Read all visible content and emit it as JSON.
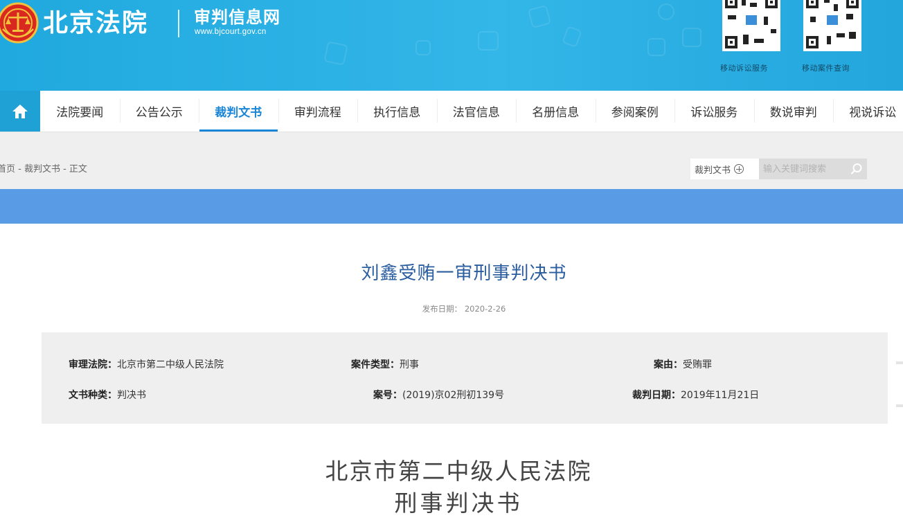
{
  "header": {
    "site_name": "北京法院",
    "subtitle": "审判信息网",
    "url": "www.bjcourt.gov.cn",
    "qr_codes": [
      {
        "caption": "移动诉讼服务"
      },
      {
        "caption": "移动案件查询"
      }
    ]
  },
  "nav": {
    "home_icon": "home-icon",
    "items": [
      {
        "label": "法院要闻"
      },
      {
        "label": "公告公示"
      },
      {
        "label": "裁判文书",
        "active": true
      },
      {
        "label": "审判流程"
      },
      {
        "label": "执行信息"
      },
      {
        "label": "法官信息"
      },
      {
        "label": "名册信息"
      },
      {
        "label": "参阅案例"
      },
      {
        "label": "诉讼服务"
      },
      {
        "label": "数说审判"
      },
      {
        "label": "视说诉讼"
      }
    ]
  },
  "breadcrumb": {
    "text": "首页 - 裁判文书 - 正文"
  },
  "search": {
    "category": "裁判文书",
    "placeholder": "输入关键词搜索"
  },
  "document": {
    "title": "刘鑫受贿一审刑事判决书",
    "publish_date_label": "发布日期：",
    "publish_date": "2020-2-26",
    "info": {
      "court_label": "审理法院：",
      "court": "北京市第二中级人民法院",
      "case_type_label": "案件类型：",
      "case_type": "刑事",
      "cause_label": "案由：",
      "cause": "受贿罪",
      "doc_kind_label": "文书种类：",
      "doc_kind": "判决书",
      "case_no_label": "案号：",
      "case_no": "(2019)京02刑初139号",
      "judgment_date_label": "裁判日期：",
      "judgment_date": "2019年11月21日"
    },
    "court_heading": "北京市第二中级人民法院",
    "doc_type_heading": "刑事判决书"
  },
  "colors": {
    "header_bg": "#2aaee2",
    "nav_home_bg": "#20a1d6",
    "active_nav": "#1a86d8",
    "blue_band": "#5a9be5",
    "title_color": "#2a5d9f"
  }
}
